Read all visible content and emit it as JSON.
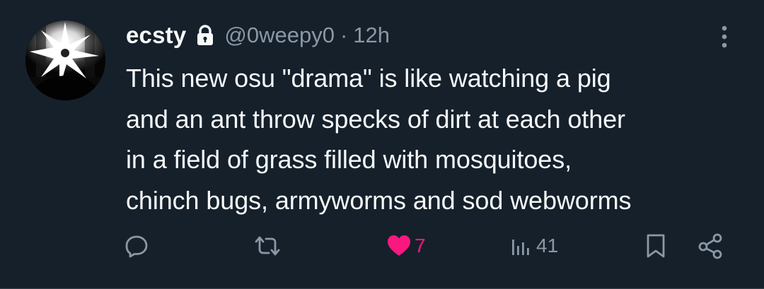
{
  "tweet": {
    "display_name": "ecsty",
    "handle": "@0weepy0",
    "separator": "·",
    "time": "12h",
    "text_lines": [
      "This new osu \"drama\" is like watching a pig",
      "and an ant throw specks of dirt at each other",
      "in a field of grass filled with mosquitoes,",
      "chinch bugs, armyworms and sod webworms"
    ]
  },
  "actions": {
    "reply_count": "",
    "retweet_count": "",
    "like_count": "7",
    "view_count": "41"
  },
  "icons": {
    "verified_lock": "lock-icon",
    "more": "more-vertical-icon",
    "reply": "reply-icon",
    "retweet": "retweet-icon",
    "like": "heart-icon",
    "views": "views-icon",
    "bookmark": "bookmark-icon",
    "share": "share-icon"
  },
  "colors": {
    "background": "#15202b",
    "text_primary": "#f7f9f9",
    "text_secondary": "#8b98a5",
    "like_pink": "#f91880",
    "icon_gray": "#8b98a5"
  }
}
